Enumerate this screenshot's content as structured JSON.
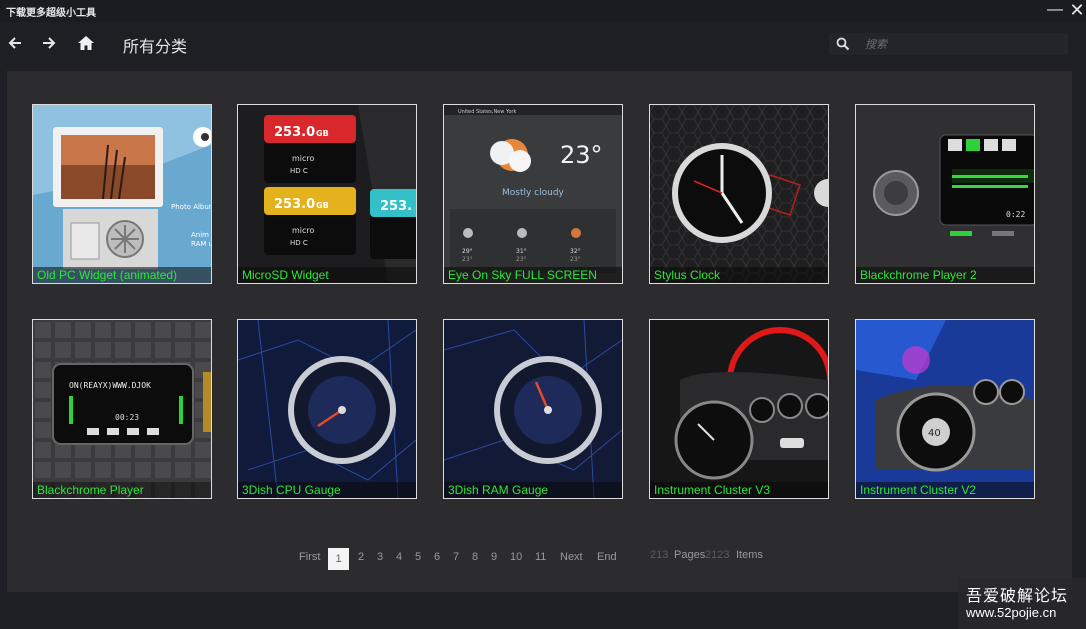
{
  "window": {
    "title": "下载更多超级小工具",
    "minimize": "—",
    "close": "✕"
  },
  "nav": {
    "title": "所有分类",
    "search_placeholder": "搜索"
  },
  "widgets": [
    {
      "label": "Old PC Widget (animated)",
      "thumb": "old-pc"
    },
    {
      "label": "MicroSD Widget",
      "thumb": "microsd",
      "texts": [
        "253.0",
        "GB",
        "253.0",
        "GB",
        "253."
      ]
    },
    {
      "label": "Eye On Sky FULL SCREEN",
      "thumb": "weather",
      "texts": [
        "23°",
        "Mostly cloudy",
        "United States,New York",
        "29°",
        "31°",
        "32°",
        "23°",
        "23°",
        "23°"
      ]
    },
    {
      "label": "Stylus Clock",
      "thumb": "clock"
    },
    {
      "label": "Blackchrome Player 2",
      "thumb": "player2",
      "texts": [
        "0:22"
      ]
    },
    {
      "label": "Blackchrome Player",
      "thumb": "player",
      "texts": [
        "ON(REAYX)WWW.DJOK",
        "00:23"
      ]
    },
    {
      "label": "3Dish CPU Gauge",
      "thumb": "cpu-gauge"
    },
    {
      "label": "3Dish RAM Gauge",
      "thumb": "ram-gauge"
    },
    {
      "label": "Instrument Cluster V3",
      "thumb": "cluster-v3"
    },
    {
      "label": "Instrument Cluster V2",
      "thumb": "cluster-v2",
      "texts": [
        "40"
      ]
    }
  ],
  "pagination": {
    "first": "First",
    "current": "1",
    "pages": [
      "2",
      "3",
      "4",
      "5",
      "6",
      "7",
      "8",
      "9",
      "10",
      "11"
    ],
    "next": "Next",
    "end": "End",
    "page_count": "213",
    "pages_label": "Pages",
    "item_count": "2123",
    "items_label": "Items"
  },
  "watermark": {
    "line1": "吾爱破解论坛",
    "line2": "www.52pojie.cn"
  },
  "colors": {
    "label_green": "#2ee63a",
    "background": "#1d1f24",
    "panel": "#2c2c2e"
  }
}
